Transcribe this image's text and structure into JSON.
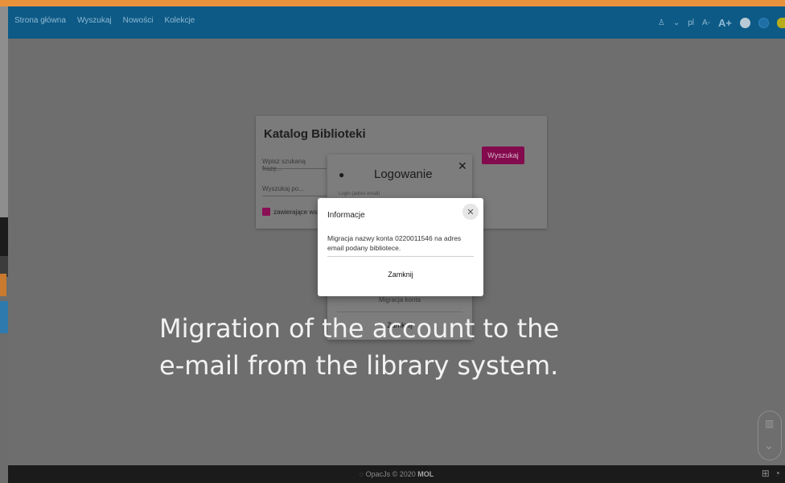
{
  "nav": {
    "links": [
      "Strona główna",
      "Wyszukaj",
      "Nowości",
      "Kolekcje"
    ],
    "lang": "pl",
    "font_smaller": "A-",
    "font_larger": "A+"
  },
  "catalog": {
    "title": "Katalog Biblioteki",
    "search_placeholder": "Wpisz szukaną frazę...",
    "search_button": "Wyszukaj",
    "search_by": "Wyszukaj po...",
    "checkbox_label": "zawierające wszystkie"
  },
  "login": {
    "title": "Logowanie",
    "field_hint": "Login (adres email)",
    "migrate_link": "Migracja konta",
    "close_button": "Zamknij"
  },
  "info": {
    "title": "Informacje",
    "message": "Migracja nazwy konta 0220011546 na adres email podany bibliotece.",
    "close_button": "Zamknij"
  },
  "caption": {
    "line1": "Migration of the account to the",
    "line2": "e-mail from the library system."
  },
  "footer": {
    "copy": "OpacJs © 2020",
    "brand": "MOL"
  }
}
